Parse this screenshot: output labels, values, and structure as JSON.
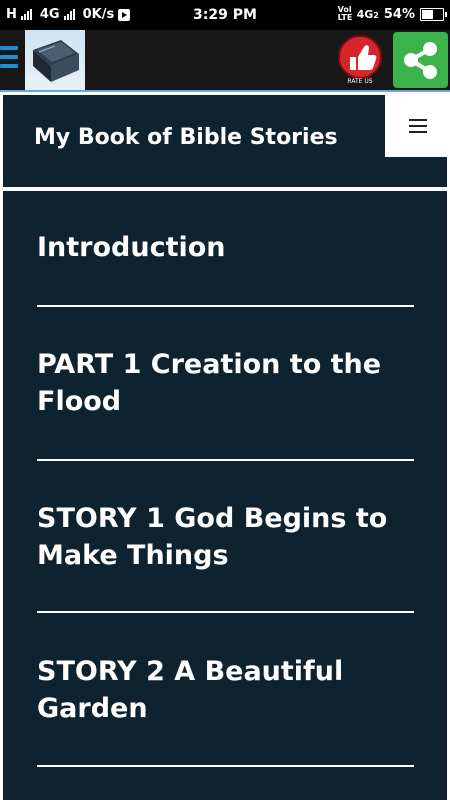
{
  "status_bar": {
    "net1_label": "H",
    "net2_label": "4G",
    "speed": "0K/s",
    "time": "3:29 PM",
    "volte_label": "Vol LTE",
    "net3_label": "4G",
    "net3_sub": "2",
    "battery_percent": "54%",
    "battery_level": 0.54
  },
  "app_bar": {
    "menu_icon": "hamburger-icon",
    "app_icon": "book-icon",
    "like_icon": "thumbs-up-icon",
    "like_caption": "RATE US",
    "share_icon": "share-icon"
  },
  "page": {
    "title": "My Book of Bible Stories",
    "nav_toggle_icon": "hamburger-icon"
  },
  "menu_items": [
    "Introduction",
    "PART 1 Creation to the Flood",
    "STORY 1 God Begins to Make Things",
    "STORY 2 A Beautiful Garden"
  ],
  "colors": {
    "panel_bg": "#0f2230",
    "share_green": "#3bb34a",
    "like_red": "#d7262b",
    "accent_blue": "#1d8fd6"
  }
}
